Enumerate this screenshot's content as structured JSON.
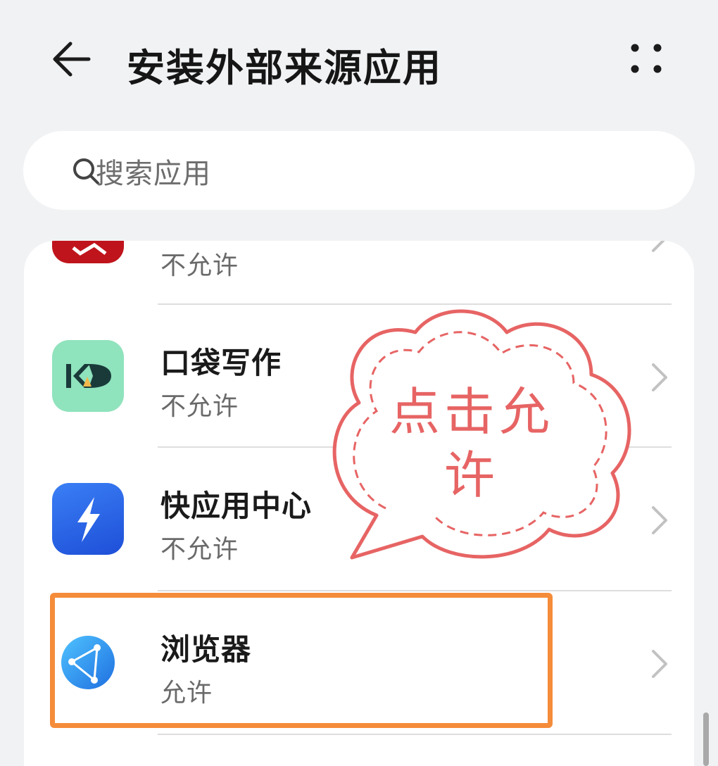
{
  "header": {
    "title": "安装外部来源应用",
    "back_icon": "arrow-left-icon",
    "more_icon": "more-dots-icon"
  },
  "search": {
    "placeholder": "搜索应用",
    "icon": "search-icon"
  },
  "apps": [
    {
      "name": "",
      "status": "不允许",
      "icon": "red-app-icon",
      "icon_color": "#c0141c"
    },
    {
      "name": "口袋写作",
      "status": "不允许",
      "icon": "kd-logo-icon",
      "icon_color": "#8fe3bd"
    },
    {
      "name": "快应用中心",
      "status": "不允许",
      "icon": "lightning-icon",
      "icon_color": "#2d6bf0"
    },
    {
      "name": "浏览器",
      "status": "允许",
      "icon": "browser-globe-icon",
      "icon_color": "#3a9af0"
    }
  ],
  "annotation": {
    "line1": "点击允",
    "line2": "许",
    "color": "#e76464",
    "highlight_color": "#f58c3a"
  }
}
